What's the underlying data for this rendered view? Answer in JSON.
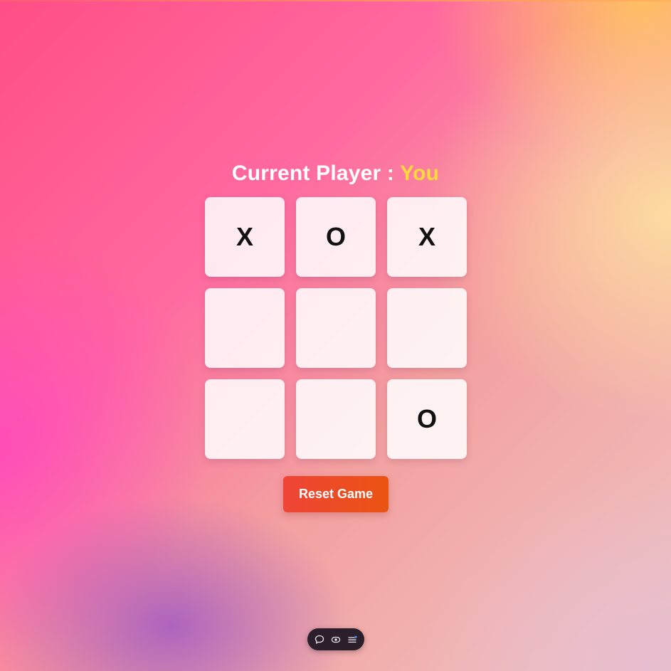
{
  "game": {
    "title_prefix": "Current Player : ",
    "current_player": "You",
    "board": [
      [
        "X",
        "O",
        "X"
      ],
      [
        "",
        "",
        ""
      ],
      [
        "",
        "",
        "O"
      ]
    ],
    "reset_label": "Reset Game"
  },
  "toolbar": {
    "icons": [
      "comment-icon",
      "eye-icon",
      "menu-icon"
    ]
  },
  "colors": {
    "current_player": "#ffd93b",
    "reset_button": "#ea5412",
    "cell": "#ffffff"
  }
}
